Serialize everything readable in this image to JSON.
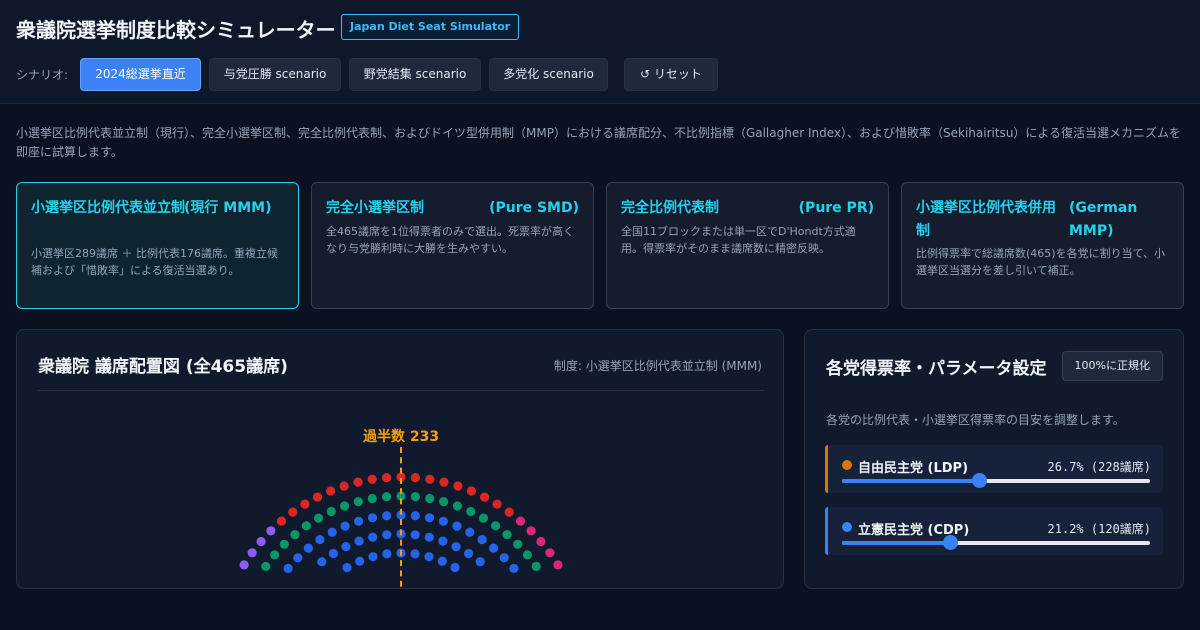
{
  "header": {
    "title": "衆議院選挙制度比較シミュレーター",
    "badge": "Japan Diet Seat Simulator",
    "scenario_label": "シナリオ:",
    "scenarios": [
      "2024総選挙直近",
      "与党圧勝 scenario",
      "野党結集 scenario",
      "多党化 scenario"
    ],
    "active_scenario": "2024総選挙直近",
    "reset_label": "↺ リセット"
  },
  "description": "小選挙区比例代表並立制（現行）、完全小選挙区制、完全比例代表制、およびドイツ型併用制（MMP）における議席配分、不比例指標（Gallagher Index）、および惜敗率（Sekihairitsu）による復活当選メカニズムを即座に試算します。",
  "systems": [
    {
      "name": "小選挙区比例代表並立制",
      "en": "(現行 MMM)",
      "desc": "小選挙区289議席 ＋ 比例代表176議席。重複立候補および「惜敗率」による復活当選あり。",
      "active": true
    },
    {
      "name": "完全小選挙区制",
      "en": "(Pure SMD)",
      "desc": "全465議席を1位得票者のみで選出。死票率が高くなり与党勝利時に大勝を生みやすい。",
      "active": false
    },
    {
      "name": "完全比例代表制",
      "en": "(Pure PR)",
      "desc": "全国11ブロックまたは単一区でD'Hondt方式適用。得票率がそのまま議席数に精密反映。",
      "active": false
    },
    {
      "name": "小選挙区比例代表併用制",
      "en": "(German MMP)",
      "desc": "比例得票率で総議席数(465)を各党に割り当て、小選挙区当選分を差し引いて補正。",
      "active": false
    }
  ],
  "chart": {
    "title": "衆議院 議席配置図 (全465議席)",
    "system_label": "制度: 小選挙区比例代表並立制 (MMM)",
    "majority_label": "過半数 233"
  },
  "chart_data": {
    "type": "parliament",
    "total_seats": 465,
    "majority": 233,
    "series": [
      {
        "name": "自由民主党 (LDP)",
        "seats": 228,
        "vote_share_pct": 26.7,
        "color": "#d97706"
      },
      {
        "name": "立憲民主党 (CDP)",
        "seats": 120,
        "vote_share_pct": 21.2,
        "color": "#3b82f6"
      }
    ]
  },
  "side": {
    "title": "各党得票率・パラメータ設定",
    "normalize_label": "100%に正規化",
    "note": "各党の比例代表・小選挙区得票率の目安を調整します。",
    "parties": [
      {
        "name": "自由民主党 (LDP)",
        "value": "26.7% (228議席)",
        "color": "#d97706",
        "level": 0.445
      },
      {
        "name": "立憲民主党 (CDP)",
        "value": "21.2% (120議席)",
        "color": "#3b82f6",
        "level": 0.35
      }
    ]
  }
}
